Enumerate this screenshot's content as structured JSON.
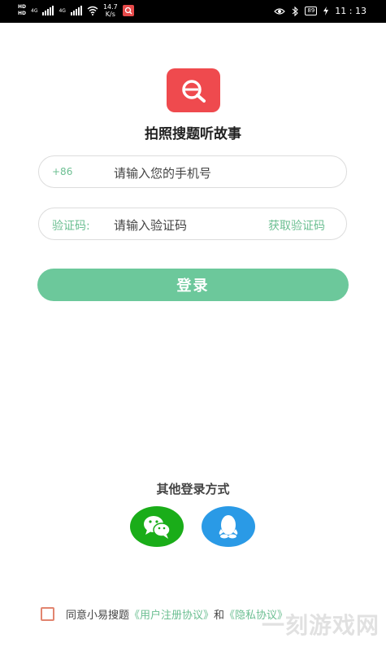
{
  "status_bar": {
    "hd1": "HD",
    "hd2": "HD",
    "net1": "4G",
    "net2": "4G",
    "speed_value": "14.7",
    "speed_unit": "K/s",
    "battery": "89",
    "time": "11 : 13",
    "icons": [
      "hd-icon",
      "signal-icon",
      "wifi-icon",
      "app-notification-icon",
      "eye-icon",
      "bluetooth-icon",
      "battery-icon",
      "charging-icon"
    ]
  },
  "header": {
    "app_name": "拍照搜题听故事"
  },
  "phone": {
    "prefix": "+86",
    "placeholder": "请输入您的手机号"
  },
  "code": {
    "label": "验证码:",
    "placeholder": "请输入验证码",
    "get_code_label": "获取验证码"
  },
  "login_button": "登录",
  "other_login": {
    "title": "其他登录方式",
    "options": [
      "wechat-icon",
      "qq-icon"
    ]
  },
  "agreement": {
    "text_prefix": "同意小易搜题",
    "user_agreement": "《用户注册协议》",
    "connector": "和",
    "privacy_policy": "《隐私协议》"
  },
  "watermark": "一刻游戏网",
  "colors": {
    "accent": "#6cc89b",
    "logo": "#ef4a4e",
    "wechat": "#1aad19",
    "qq": "#2a9ae6"
  }
}
